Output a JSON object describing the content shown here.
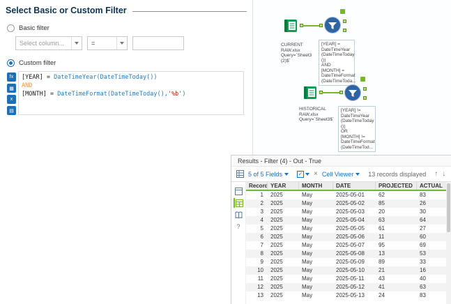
{
  "colors": {
    "accent_blue": "#1f6fb5",
    "alteryx_green": "#76b82a",
    "title_navy": "#0d3353",
    "filter_tool_blue": "#2e63a4",
    "input_tool_green": "#0f9d58"
  },
  "icons": {
    "functions": "fx",
    "columns": "▦",
    "variables": "x",
    "saved": "▤",
    "check": "✓",
    "close": "×",
    "arrow_up": "↑",
    "arrow_down": "↓",
    "question": "?"
  },
  "config": {
    "title": "Select Basic or Custom Filter",
    "basic_filter_label": "Basic filter",
    "column_placeholder": "Select column...",
    "operator_value": "=",
    "value_input": "",
    "custom_filter_label": "Custom filter",
    "expression_lines": [
      [
        [
          "[YEAR]",
          "plain"
        ],
        [
          " = ",
          "plain"
        ],
        [
          "DateTimeYear(DateTimeToday())",
          "fn"
        ]
      ],
      [
        [
          "AND",
          "kw"
        ]
      ],
      [
        [
          "[MONTH]",
          "plain"
        ],
        [
          " = ",
          "plain"
        ],
        [
          "DateTimeFormat(DateTimeToday(),",
          "fn"
        ],
        [
          "'%b'",
          "str"
        ],
        [
          ")",
          "fn"
        ]
      ]
    ]
  },
  "canvas": {
    "tool1_annotation": "CURRENT\nRAW.xlsx\nQuery=`Sheet3\n(2)$`",
    "filter1_annotation": "[YEAR] =\nDateTimeYear\n(DateTimeToday\n())\nAND\n[MONTH] =\nDateTimeFormat\n(DateTimeToda...",
    "tool2_annotation": "HISTORICAL\nRAW.xlsx\nQuery=`Sheet3$`",
    "filter2_annotation": "[YEAR] !=\nDateTimeYear\n(DateTimeToday\n())\nOR\n[MONTH] !=\nDateTimeFormat\n(DateTimeTod..."
  },
  "results": {
    "title": "Results - Filter (4) - Out - True",
    "toolbar": {
      "fields_label": "5 of 5 Fields",
      "cell_viewer_label": "Cell Viewer",
      "records_label": "13 records displayed"
    },
    "table": {
      "columns": [
        "Record",
        "YEAR",
        "MONTH",
        "DATE",
        "PROJECTED",
        "ACTUAL"
      ],
      "rows": [
        [
          "1",
          "2025",
          "May",
          "2025-05-01",
          "62",
          "83"
        ],
        [
          "2",
          "2025",
          "May",
          "2025-05-02",
          "85",
          "26"
        ],
        [
          "3",
          "2025",
          "May",
          "2025-05-03",
          "20",
          "30"
        ],
        [
          "4",
          "2025",
          "May",
          "2025-05-04",
          "63",
          "64"
        ],
        [
          "5",
          "2025",
          "May",
          "2025-05-05",
          "61",
          "27"
        ],
        [
          "6",
          "2025",
          "May",
          "2025-05-06",
          "11",
          "60"
        ],
        [
          "7",
          "2025",
          "May",
          "2025-05-07",
          "95",
          "69"
        ],
        [
          "8",
          "2025",
          "May",
          "2025-05-08",
          "13",
          "53"
        ],
        [
          "9",
          "2025",
          "May",
          "2025-05-09",
          "89",
          "33"
        ],
        [
          "10",
          "2025",
          "May",
          "2025-05-10",
          "21",
          "16"
        ],
        [
          "11",
          "2025",
          "May",
          "2025-05-11",
          "43",
          "40"
        ],
        [
          "12",
          "2025",
          "May",
          "2025-05-12",
          "41",
          "63"
        ],
        [
          "13",
          "2025",
          "May",
          "2025-05-13",
          "24",
          "83"
        ]
      ]
    }
  }
}
